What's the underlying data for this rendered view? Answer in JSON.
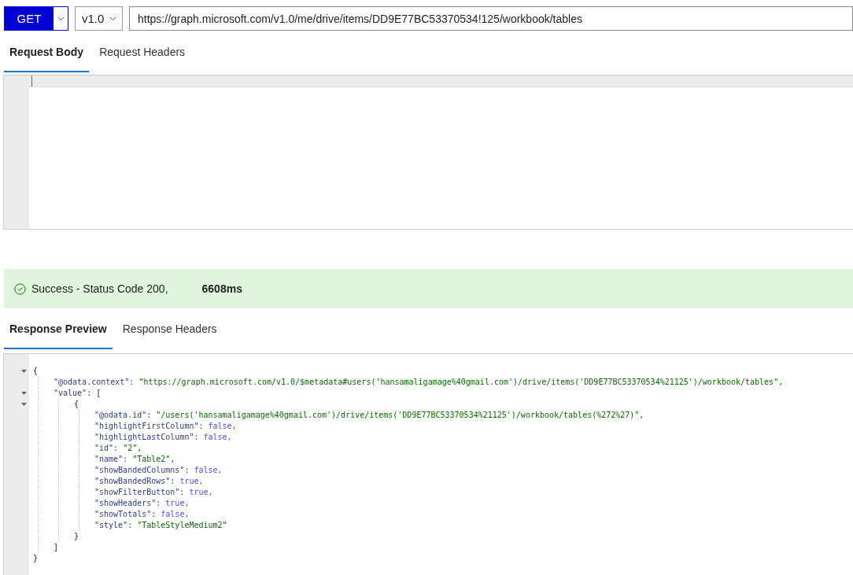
{
  "request": {
    "method": "GET",
    "version": "v1.0",
    "url": "https://graph.microsoft.com/v1.0/me/drive/items/DD9E77BC53370534!125/workbook/tables"
  },
  "request_tabs": [
    {
      "label": "Request Body",
      "selected": true
    },
    {
      "label": "Request Headers",
      "selected": false
    }
  ],
  "status": {
    "message": "Success - Status Code 200,",
    "duration": "6608ms"
  },
  "response_tabs": [
    {
      "label": "Response Preview",
      "selected": true
    },
    {
      "label": "Response Headers",
      "selected": false
    }
  ],
  "response_body": {
    "open": "{",
    "expanded": true,
    "close": "}",
    "children": [
      {
        "key": "\"@odata.context\":",
        "value": "\"https://graph.microsoft.com/v1.0/$metadata#users('hansamaligamage%40gmail.com')/drive/items('DD9E77BC53370534%21125')/workbook/tables\",",
        "kind": "string"
      },
      {
        "key": "\"value\":",
        "open": "[",
        "expanded": true,
        "close": "]",
        "children": [
          {
            "open": "{",
            "expanded": true,
            "close": "}",
            "children": [
              {
                "key": "\"@odata.id\":",
                "value": "\"/users('hansamaligamage%40gmail.com')/drive/items('DD9E77BC53370534%21125')/workbook/tables(%272%27)\",",
                "kind": "string"
              },
              {
                "key": "\"highlightFirstColumn\":",
                "value": "false,",
                "kind": "boolean"
              },
              {
                "key": "\"highlightLastColumn\":",
                "value": "false,",
                "kind": "boolean"
              },
              {
                "key": "\"id\":",
                "value": "\"2\",",
                "kind": "string"
              },
              {
                "key": "\"name\":",
                "value": "\"Table2\",",
                "kind": "string"
              },
              {
                "key": "\"showBandedColumns\":",
                "value": "false,",
                "kind": "boolean"
              },
              {
                "key": "\"showBandedRows\":",
                "value": "true,",
                "kind": "boolean"
              },
              {
                "key": "\"showFilterButton\":",
                "value": "true,",
                "kind": "boolean"
              },
              {
                "key": "\"showHeaders\":",
                "value": "true,",
                "kind": "boolean"
              },
              {
                "key": "\"showTotals\":",
                "value": "false,",
                "kind": "boolean"
              },
              {
                "key": "\"style\":",
                "value": "\"TableStyleMedium2\"",
                "kind": "string"
              }
            ]
          }
        ]
      }
    ]
  }
}
